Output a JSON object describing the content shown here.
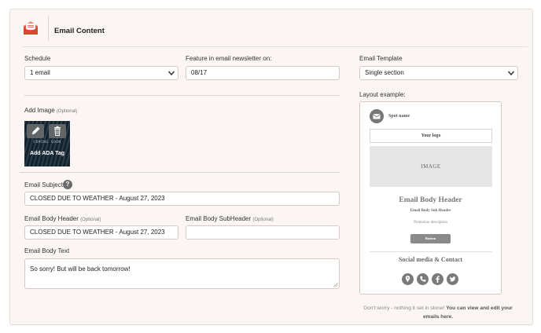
{
  "header": {
    "title": "Email Content",
    "icon": "envelope-icon"
  },
  "schedule": {
    "label": "Schedule",
    "value": "1 email"
  },
  "feature": {
    "label": "Feature in email newsletter on:",
    "value": "08/17"
  },
  "template": {
    "label": "Email Template",
    "value": "Single section"
  },
  "add_image": {
    "label": "Add Image",
    "optional": "(Optional)",
    "thumb_text": "COMING SOON",
    "ada_tag": "Add ADA Tag",
    "edit_icon": "pencil-icon",
    "delete_icon": "trash-icon"
  },
  "subject": {
    "label": "Email Subject",
    "help": "?",
    "value": "CLOSED DUE TO WEATHER - August 27, 2023"
  },
  "body_header": {
    "label": "Email Body Header",
    "optional": "(Optional)",
    "value": "CLOSED DUE TO WEATHER - August 27, 2023"
  },
  "body_subheader": {
    "label": "Email Body SubHeader",
    "optional": "(Optional)",
    "value": ""
  },
  "body_text": {
    "label": "Email Body Text",
    "value": "So sorry! But will be back tomorrow!"
  },
  "layout": {
    "label": "Layout example:",
    "spot_name": "Spot name",
    "logo": "Your logo",
    "image": "IMAGE",
    "header": "Email Body Header",
    "subheader": "Email Body Sub Headre",
    "promo": "Promotion description",
    "button": "Button",
    "social": "Social media & Contact",
    "social_icons": [
      "location-icon",
      "phone-icon",
      "facebook-icon",
      "twitter-icon"
    ]
  },
  "footer": {
    "text": "Don't worry - nothing it set in stone!",
    "link_text": "You can view and edit your emails here."
  },
  "colors": {
    "accent": "#e8553a",
    "card_bg": "#fbf6f4",
    "border": "#d7c8c4"
  }
}
